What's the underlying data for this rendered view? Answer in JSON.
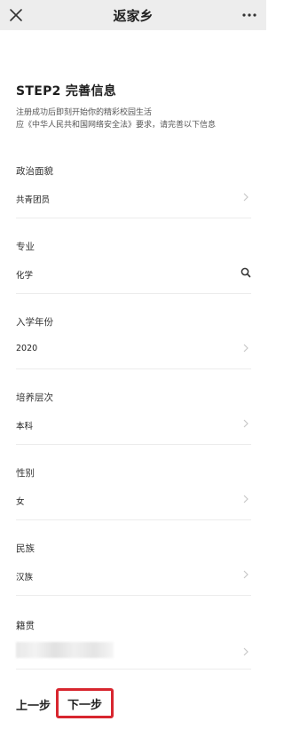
{
  "topbar": {
    "title": "返家乡"
  },
  "header": {
    "step_title": "STEP2 完善信息",
    "desc_line1": "注册成功后即刻开始你的精彩校园生活",
    "desc_line2": "应《中华人民共和国网络安全法》要求，请完善以下信息"
  },
  "fields": [
    {
      "label": "政治面貌",
      "value": "共青团员",
      "trail": "chevron-right-icon"
    },
    {
      "label": "专业",
      "value": "化学",
      "trail": "search-icon"
    },
    {
      "label": "入学年份",
      "value": "2020",
      "trail": "chevron-right-icon"
    },
    {
      "label": "培养层次",
      "value": "本科",
      "trail": "chevron-right-icon"
    },
    {
      "label": "性别",
      "value": "女",
      "trail": "chevron-right-icon"
    },
    {
      "label": "民族",
      "value": "汉族",
      "trail": "chevron-right-icon"
    },
    {
      "label": "籍贯",
      "value": "",
      "trail": "chevron-right-icon"
    }
  ],
  "nav": {
    "prev_label": "上一步",
    "next_label": "下一步"
  },
  "colors": {
    "highlight": "#d8262f",
    "topbar_bg": "#ededed"
  }
}
